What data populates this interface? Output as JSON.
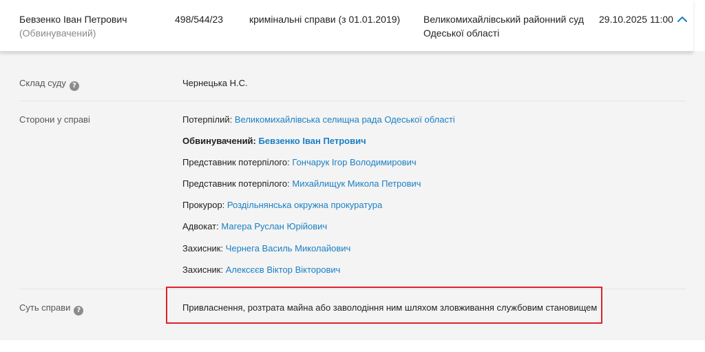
{
  "case": {
    "defendant_name": "Бевзенко Іван Петрович",
    "defendant_role": "(Обвинувачений)",
    "case_number": "498/544/23",
    "case_type": "кримінальні справи (з 01.01.2019)",
    "court_line1": "Великомихайлівський районний суд",
    "court_line2": "Одеської області",
    "date": "29.10.2025 11:00"
  },
  "details": {
    "composition_label": "Склад суду",
    "composition_value": "Чернецька Н.С.",
    "parties_label": "Сторони у справі",
    "parties": [
      {
        "role": "Потерпілий:",
        "name": "Великомихайлівська селищна рада Одеської області"
      },
      {
        "role": "Обвинувачений:",
        "name": "Бевзенко Іван Петрович"
      },
      {
        "role": "Представник потерпілого:",
        "name": "Гончарук Ігор Володимирович"
      },
      {
        "role": "Представник потерпілого:",
        "name": "Михайлищук Микола Петрович"
      },
      {
        "role": "Прокурор:",
        "name": "Роздільнянська окружна прокуратура"
      },
      {
        "role": "Адвокат:",
        "name": "Магера Руслан Юрійович"
      },
      {
        "role": "Захисник:",
        "name": "Чернега Василь Миколайович"
      },
      {
        "role": "Захисник:",
        "name": "Алексєєв Віктор Вікторович"
      }
    ],
    "essence_label": "Суть справи",
    "essence_value": "Привласнення, розтрата майна або заволодіння ним шляхом зловживання службовим становищем"
  },
  "icons": {
    "help": "question-circle-icon",
    "toggle": "chevron-up-icon"
  },
  "colors": {
    "link": "#1a7fc4",
    "highlight": "#e0202a"
  }
}
